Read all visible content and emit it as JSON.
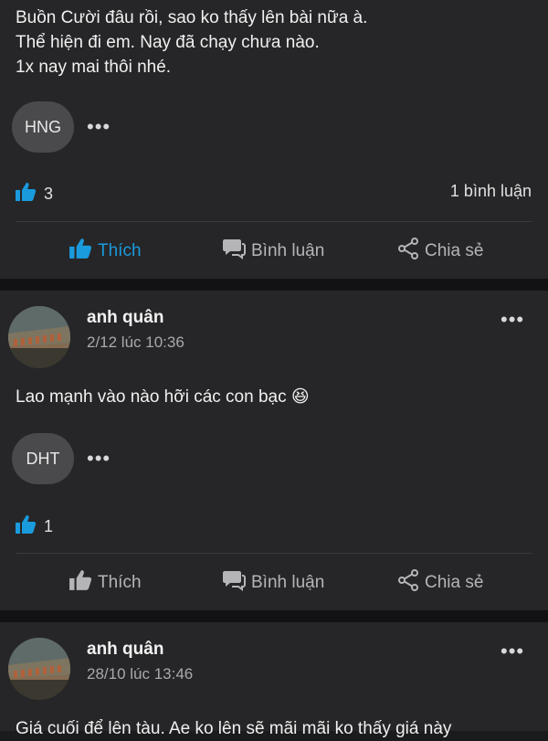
{
  "post1": {
    "lines": [
      "Buồn Cười đâu rồi, sao ko thấy lên bài nữa à.",
      "Thể hiện đi em. Nay đã chạy chưa nào.",
      "1x nay mai thôi nhé."
    ],
    "commenter_initials": "HNG",
    "like_count": "3",
    "comment_count": "1 bình luận",
    "liked": true
  },
  "post2": {
    "author": "anh quân",
    "date": "2/12 lúc 10:36",
    "text": "Lao mạnh vào nào hỡi các con bạc",
    "emoji": "😆",
    "commenter_initials": "DHT",
    "like_count": "1",
    "liked": false
  },
  "post3": {
    "author": "anh quân",
    "date": "28/10 lúc 13:46",
    "text": "Giá cuối để lên tàu. Ae ko lên sẽ mãi mãi ko thấy giá này"
  },
  "actions": {
    "like": "Thích",
    "comment": "Bình luận",
    "share": "Chia sẻ"
  },
  "colors": {
    "accent": "#1a9bde",
    "background": "#262628",
    "separator": "#121214"
  },
  "icons": {
    "more": "more-dots-icon",
    "like": "thumbs-up-icon",
    "comment": "comment-icon",
    "share": "share-icon"
  }
}
